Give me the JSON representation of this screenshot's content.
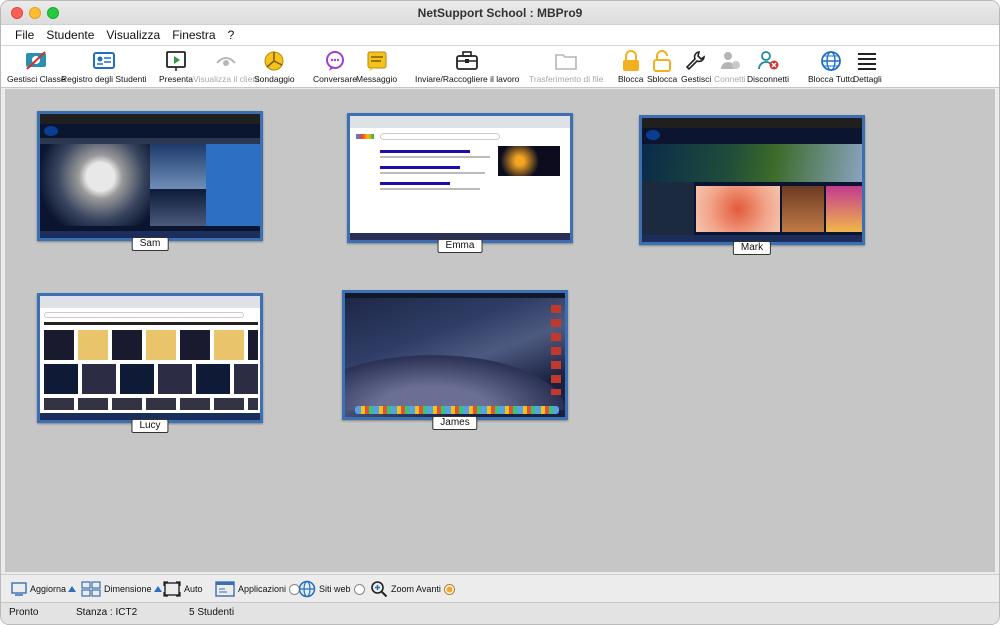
{
  "window": {
    "title": "NetSupport School : MBPro9"
  },
  "menu": [
    "File",
    "Studente",
    "Visualizza",
    "Finestra",
    "?"
  ],
  "toolbar": {
    "gestisci_classe": "Gestisci Classe",
    "registro": "Registro degli Studenti",
    "presenta": "Presenta",
    "visualizza_client": "Visualizza il client",
    "sondaggio": "Sondaggio",
    "conversare": "Conversare",
    "messaggio": "Messaggio",
    "inviare": "Inviare/Raccogliere il lavoro",
    "trasferimento": "Trasferimento di file",
    "blocca": "Blocca",
    "sblocca": "Sblocca",
    "gestisci": "Gestisci",
    "connetti": "Connetti",
    "disconnetti": "Disconnetti",
    "blocca_tutto": "Blocca Tutto",
    "dettagli": "Dettagli"
  },
  "students": [
    {
      "name": "Sam"
    },
    {
      "name": "Emma"
    },
    {
      "name": "Mark"
    },
    {
      "name": "Lucy"
    },
    {
      "name": "James"
    }
  ],
  "bottom": {
    "aggiorna": "Aggiorna",
    "dimensione": "Dimensione",
    "auto": "Auto",
    "applicazioni": "Applicazioni",
    "siti_web": "Siti web",
    "zoom_avanti": "Zoom Avanti"
  },
  "status": {
    "state": "Pronto",
    "room": "Stanza : ICT2",
    "count": "5 Studenti"
  },
  "colors": {
    "thumb_border": "#3d6fb4",
    "grid_bg": "#c6c6c6",
    "accent_blue": "#1f6fc5",
    "lock_yellow": "#f2b01e"
  }
}
